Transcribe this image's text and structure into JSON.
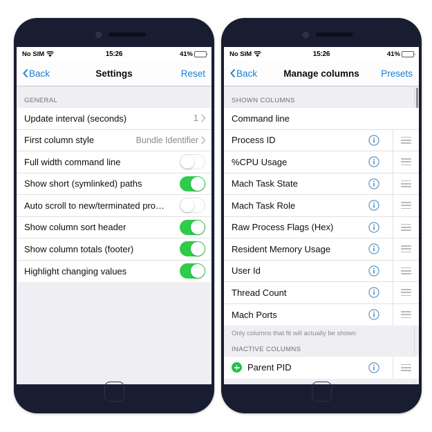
{
  "status_bar": {
    "carrier": "No SIM",
    "wifi_icon": "wifi-icon",
    "time": "15:26",
    "battery_percent": "41%",
    "battery_icon": "battery-icon"
  },
  "colors": {
    "accent_blue": "#1a7ed6",
    "toggle_on_green": "#2ecc4a",
    "plus_green": "#23c14b",
    "section_bg": "#eeeef3",
    "phone_frame": "#181d31"
  },
  "left_phone": {
    "navbar": {
      "back_label": "Back",
      "back_icon": "chevron-left-icon",
      "title": "Settings",
      "action_label": "Reset"
    },
    "section_header": "GENERAL",
    "rows": [
      {
        "label": "Update interval (seconds)",
        "type": "disclosure",
        "value": "1",
        "icon": "chevron-right-icon"
      },
      {
        "label": "First column style",
        "type": "disclosure",
        "value": "Bundle Identifier",
        "icon": "chevron-right-icon"
      },
      {
        "label": "Full width command line",
        "type": "toggle",
        "on": false
      },
      {
        "label": "Show short (symlinked) paths",
        "type": "toggle",
        "on": true
      },
      {
        "label": "Auto scroll to new/terminated pro…",
        "type": "toggle",
        "on": false
      },
      {
        "label": "Show column sort header",
        "type": "toggle",
        "on": true
      },
      {
        "label": "Show column totals (footer)",
        "type": "toggle",
        "on": true
      },
      {
        "label": "Highlight changing values",
        "type": "toggle",
        "on": true
      }
    ]
  },
  "right_phone": {
    "navbar": {
      "back_label": "Back",
      "back_icon": "chevron-left-icon",
      "title": "Manage columns",
      "action_label": "Presets"
    },
    "shown_section_header": "SHOWN COLUMNS",
    "shown_columns": [
      {
        "label": "Command line",
        "info": false,
        "grip": false
      },
      {
        "label": "Process ID",
        "info": true,
        "grip": true
      },
      {
        "label": "%CPU Usage",
        "info": true,
        "grip": true
      },
      {
        "label": "Mach Task State",
        "info": true,
        "grip": true
      },
      {
        "label": "Mach Task Role",
        "info": true,
        "grip": true
      },
      {
        "label": "Raw Process Flags (Hex)",
        "info": true,
        "grip": true
      },
      {
        "label": "Resident Memory Usage",
        "info": true,
        "grip": true
      },
      {
        "label": "User Id",
        "info": true,
        "grip": true
      },
      {
        "label": "Thread Count",
        "info": true,
        "grip": true
      },
      {
        "label": "Mach Ports",
        "info": true,
        "grip": true
      }
    ],
    "footer_note": "Only columns that fit will actually be shown",
    "inactive_section_header": "INACTIVE COLUMNS",
    "inactive_columns": [
      {
        "label": "Parent PID",
        "add_icon": "plus-circle-icon",
        "info": true,
        "grip": true
      }
    ]
  }
}
